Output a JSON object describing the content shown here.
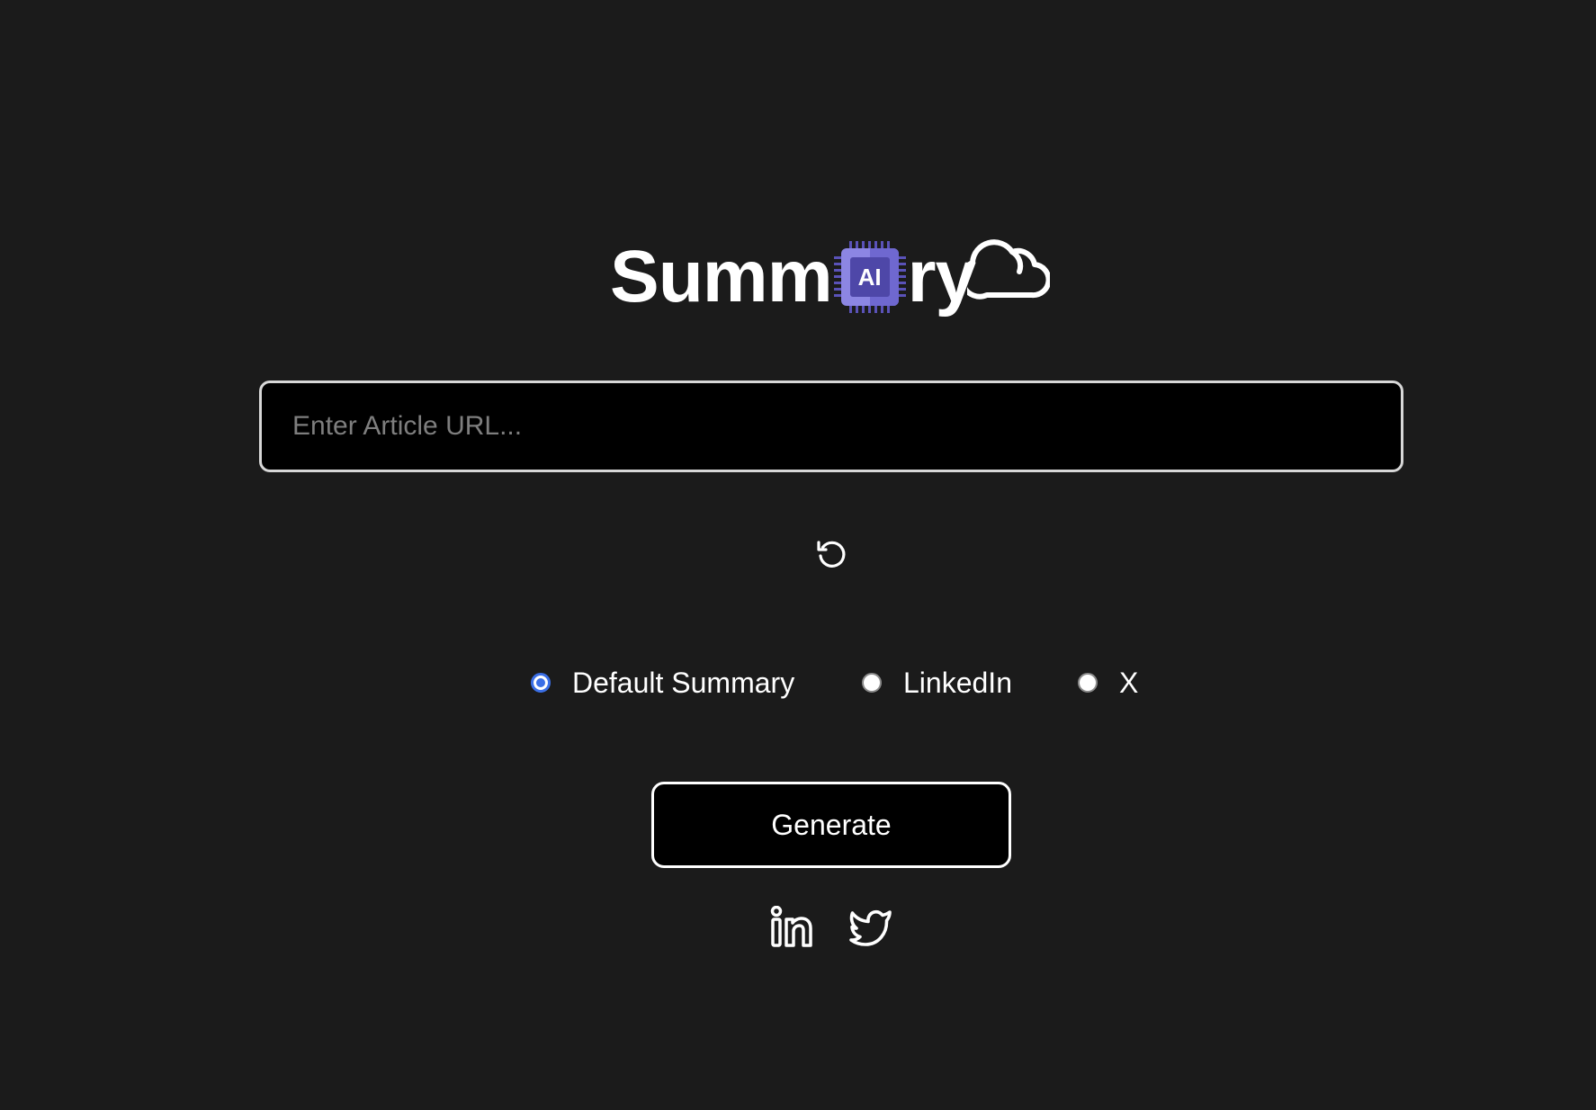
{
  "logo": {
    "text_before": "Summ",
    "chip_text": "AI",
    "text_after": "ry"
  },
  "url_input": {
    "placeholder": "Enter Article URL...",
    "value": ""
  },
  "reset": {
    "icon": "refresh-icon"
  },
  "summary_types": {
    "selected": "Default Summary",
    "options": [
      {
        "label": "Default Summary",
        "checked": true
      },
      {
        "label": "LinkedIn",
        "checked": false
      },
      {
        "label": "X",
        "checked": false
      }
    ]
  },
  "generate": {
    "label": "Generate"
  },
  "social_links": [
    {
      "icon": "linkedin-icon"
    },
    {
      "icon": "twitter-icon"
    }
  ],
  "colors": {
    "background": "#1b1b1b",
    "accent": "#3b6fe6",
    "chip_primary": "#5a52b8",
    "chip_light": "#8c86e3"
  }
}
